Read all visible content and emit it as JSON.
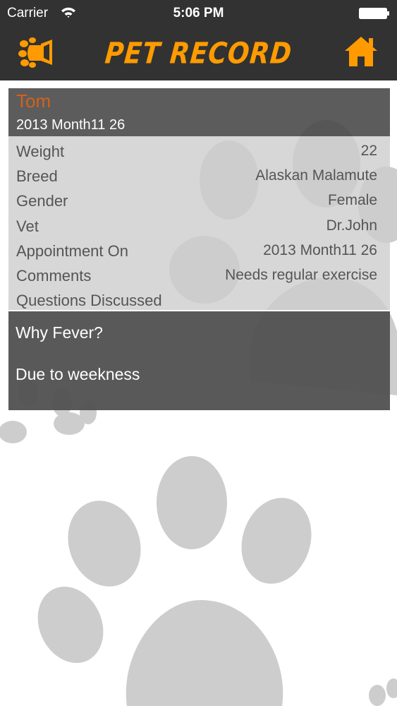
{
  "status_bar": {
    "carrier": "Carrier",
    "time": "5:06 PM"
  },
  "nav": {
    "title": "PET RECORD"
  },
  "record": {
    "pet_name": "Tom",
    "date": "2013 Month11 26",
    "details": [
      {
        "label": "Weight",
        "value": "22"
      },
      {
        "label": "Breed",
        "value": "Alaskan Malamute"
      },
      {
        "label": "Gender",
        "value": "Female"
      },
      {
        "label": "Vet",
        "value": "Dr.John"
      },
      {
        "label": "Appointment On",
        "value": "2013 Month11 26"
      },
      {
        "label": "Comments",
        "value": "Needs regular exercise"
      },
      {
        "label": "Questions Discussed",
        "value": ""
      }
    ],
    "question": "Why Fever?",
    "answer": "Due to weekness"
  },
  "colors": {
    "bar": "#323232",
    "accent": "#ff9b00",
    "pet_name": "#d4621a"
  }
}
